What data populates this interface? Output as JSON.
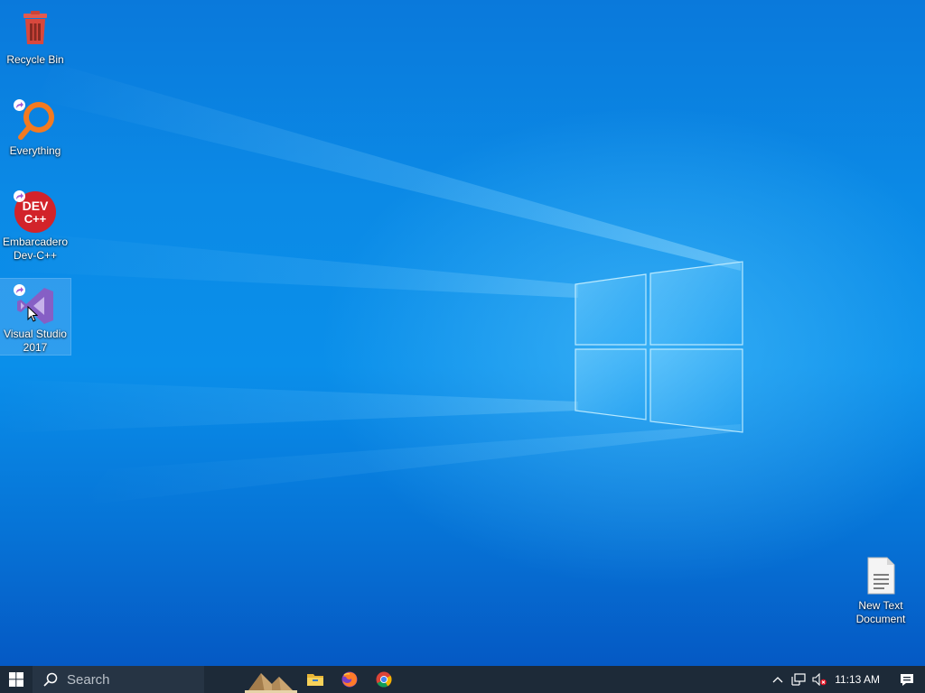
{
  "desktop": {
    "icons": [
      {
        "label": "Recycle Bin",
        "icon": "recycle-bin-icon"
      },
      {
        "label": "Everything",
        "icon": "everything-search-icon",
        "shortcut": true
      },
      {
        "label": "Embarcadero\nDev-C++",
        "icon": "dev-cpp-icon",
        "badge_text": "DEV\nC++",
        "shortcut": true
      },
      {
        "label": "Visual Studio\n2017",
        "icon": "visual-studio-icon",
        "shortcut": true,
        "selected": true
      },
      {
        "label": "New Text\nDocument",
        "icon": "text-document-icon"
      }
    ]
  },
  "taskbar": {
    "search_placeholder": "Search",
    "pinned": [
      "file-explorer-icon",
      "firefox-icon",
      "chrome-icon"
    ],
    "clock": "11:13 AM"
  },
  "colors": {
    "taskbar": "#1d2a38",
    "accent": "#0a8fea",
    "vs_purple": "#865fc5",
    "dev_red": "#d2232a",
    "everything_orange": "#f47a20"
  }
}
